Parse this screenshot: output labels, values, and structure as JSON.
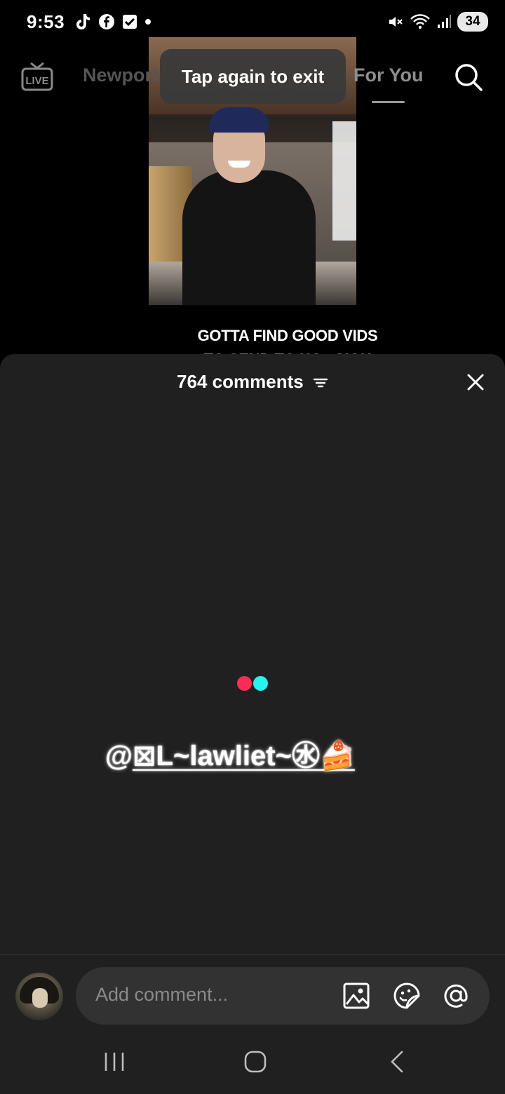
{
  "status_bar": {
    "time": "9:53",
    "left_icons": [
      "tiktok-icon",
      "facebook-icon",
      "checkbox-icon",
      "dot-icon"
    ],
    "right_icons": [
      "mute-icon",
      "wifi-icon",
      "signal-icon"
    ],
    "battery": "34"
  },
  "top_nav": {
    "live_icon": "live-tv-icon",
    "tab_nearby": "Newport",
    "tab_foryou": "For You",
    "search_icon": "search-icon"
  },
  "toast": {
    "text": "Tap again to exit"
  },
  "video": {
    "caption_line1": "GOTTA FIND GOOD VIDS",
    "caption_line2": "TO SEND TO HG.. SIGH"
  },
  "comments": {
    "count_label": "764 comments",
    "filter_icon": "filter-icon",
    "close_icon": "close-icon",
    "loader_colors": [
      "#fe2c55",
      "#25f4ee"
    ],
    "mention_at": "@",
    "mention_user": "⊠L~lawliet~㊌🍰"
  },
  "composer": {
    "placeholder": "Add comment...",
    "icons": [
      "image-icon",
      "sticker-icon",
      "at-mention-icon"
    ]
  },
  "android_nav": {
    "buttons": [
      "recents-button",
      "home-button",
      "back-button"
    ]
  },
  "colors": {
    "sheet_bg": "#202020",
    "input_bg": "#323232",
    "accent_red": "#fe2c55",
    "accent_cyan": "#25f4ee"
  }
}
